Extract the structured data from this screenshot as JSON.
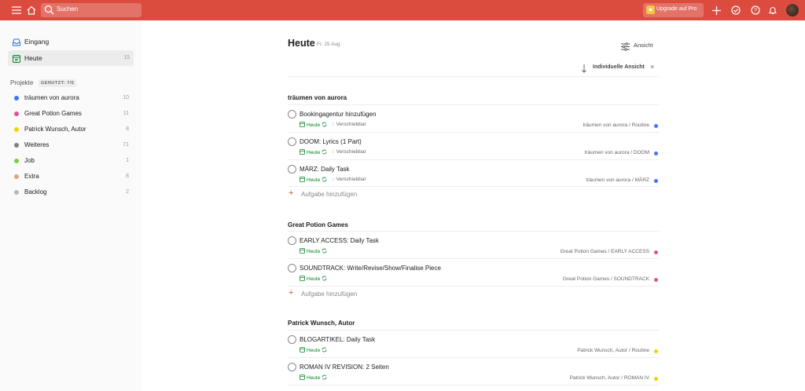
{
  "search": {
    "placeholder": "Suchen"
  },
  "header": {
    "upgrade_label": "Upgrade auf Pro"
  },
  "sidebar": {
    "inbox": {
      "label": "Eingang"
    },
    "today": {
      "label": "Heute",
      "count": "15"
    },
    "projects_heading": "Projekte",
    "projects_badge": "GENUTZT: 7/5",
    "projects": [
      {
        "label": "träumen von aurora",
        "count": "10",
        "color": "#4073ff"
      },
      {
        "label": "Great Potion Games",
        "count": "11",
        "color": "#e05194"
      },
      {
        "label": "Patrick Wunsch, Autor",
        "count": "8",
        "color": "#fad000"
      },
      {
        "label": "Weiteres",
        "count": "71",
        "color": "#808080"
      },
      {
        "label": "Job",
        "count": "1",
        "color": "#7ecc49"
      },
      {
        "label": "Extra",
        "count": "8",
        "color": "#e0a47e"
      },
      {
        "label": "Backlog",
        "count": "2",
        "color": "#b8b8b8"
      }
    ]
  },
  "main": {
    "title": "Heute",
    "date": "Fr. 25 Aug",
    "view_label": "Ansicht",
    "custom_view_label": "Individuelle Ansicht",
    "add_task_label": "Aufgabe hinzufügen",
    "sections": [
      {
        "title": "träumen von aurora",
        "tasks": [
          {
            "title": "Bookingagentur hinzufügen",
            "due": "Heute",
            "movable": "Verschiebbar",
            "path": "träumen von aurora / Routine",
            "color": "#4073ff"
          },
          {
            "title": "DOOM: Lyrics (1 Part)",
            "due": "Heute",
            "movable": "Verschiebbar",
            "path": "träumen von aurora / DOOM",
            "color": "#4073ff"
          },
          {
            "title": "MÄRZ: Daily Task",
            "due": "Heute",
            "movable": "Verschiebbar",
            "path": "träumen von aurora / MÄRZ",
            "color": "#4073ff"
          }
        ]
      },
      {
        "title": "Great Potion Games",
        "tasks": [
          {
            "title": "EARLY ACCESS: Daily Task",
            "due": "Heute",
            "path": "Great Potion Games / EARLY ACCESS",
            "color": "#e05194"
          },
          {
            "title": "SOUNDTRACK: Write/Revise/Show/Finalise Piece",
            "due": "Heute",
            "path": "Great Potion Games / SOUNDTRACK",
            "color": "#e05194"
          }
        ]
      },
      {
        "title": "Patrick Wunsch, Autor",
        "tasks": [
          {
            "title": "BLOGARTIKEL: Daily Task",
            "due": "Heute",
            "path": "Patrick Wunsch, Autor / Routine",
            "color": "#fad000"
          },
          {
            "title": "ROMAN IV REVISION: 2 Seiten",
            "due": "Heute",
            "path": "Patrick Wunsch, Autor / ROMAN IV",
            "color": "#fad000"
          }
        ]
      }
    ]
  }
}
